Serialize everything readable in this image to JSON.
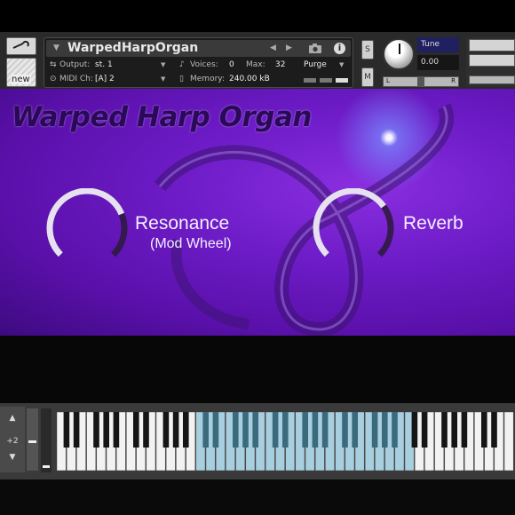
{
  "header": {
    "instrument_name": "WarpedHarpOrgan",
    "output_label": "Output:",
    "output_value": "st. 1",
    "voices_label": "Voices:",
    "voices_value": "0",
    "max_label": "Max:",
    "max_value": "32",
    "purge_label": "Purge",
    "midi_label": "MIDI Ch:",
    "midi_value": "[A]  2",
    "memory_label": "Memory:",
    "memory_value": "240.00 kB",
    "solo_label": "S",
    "mute_label": "M",
    "tune_label": "Tune",
    "tune_value": "0.00",
    "pan_left": "L",
    "pan_right": "R",
    "new_label": "new"
  },
  "main": {
    "title": "Warped Harp Organ",
    "controls": [
      {
        "label": "Resonance",
        "sublabel": "(Mod Wheel)",
        "value": 0.75
      },
      {
        "label": "Reverb",
        "sublabel": "",
        "value": 0.7
      }
    ]
  },
  "keyboard": {
    "octave_label": "+2",
    "highlight_color": "#a8cfe0"
  },
  "colors": {
    "accent_purple": "#6e1cc8",
    "dial_track": "#2a1a3a",
    "dial_fill": "#e6e0f0"
  }
}
